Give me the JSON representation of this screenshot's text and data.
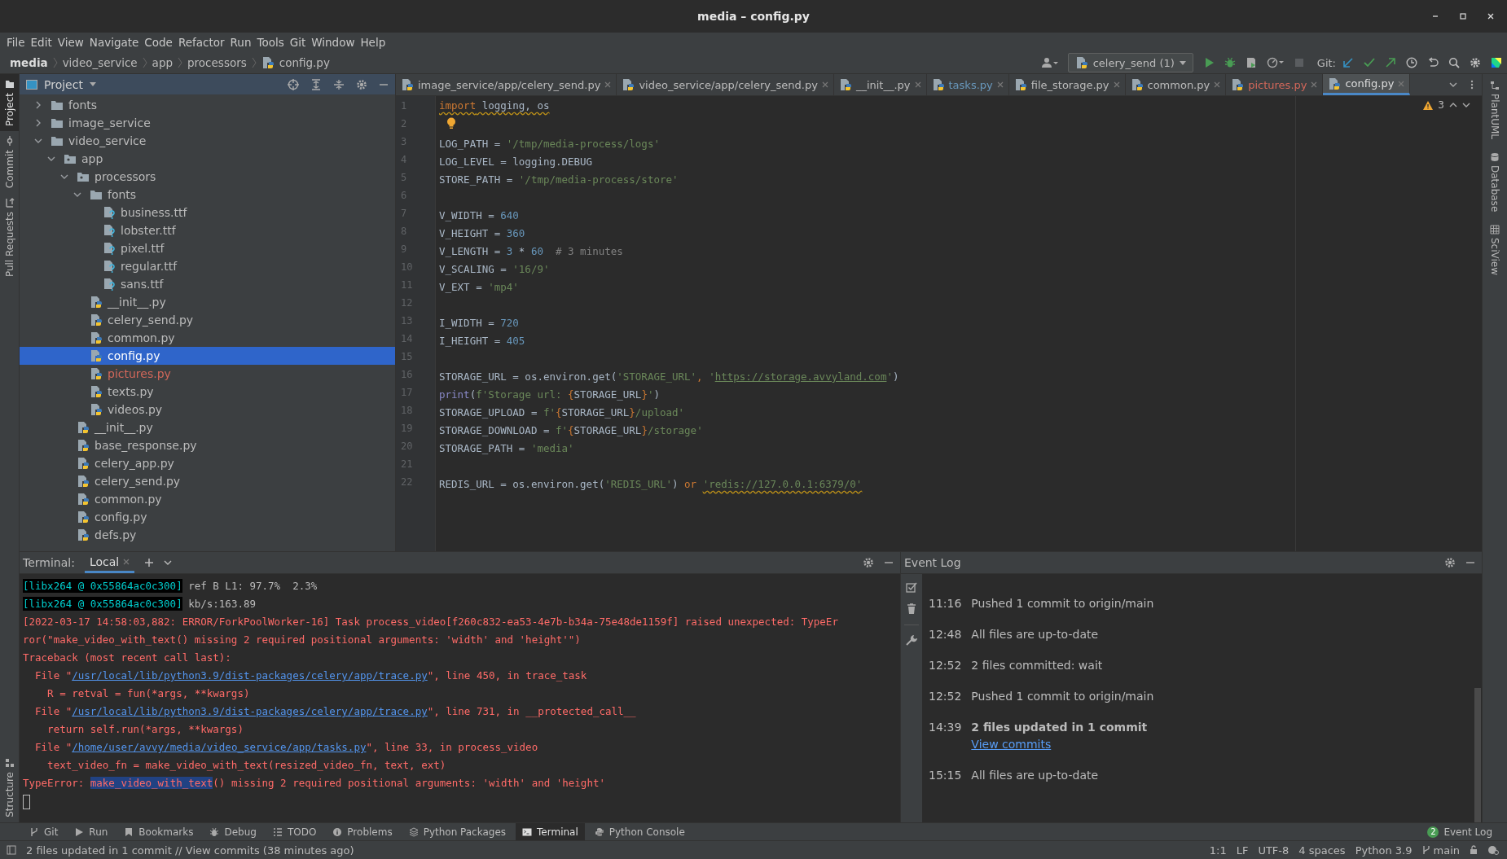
{
  "window": {
    "title": "media – config.py"
  },
  "menu": [
    "File",
    "Edit",
    "View",
    "Navigate",
    "Code",
    "Refactor",
    "Run",
    "Tools",
    "Git",
    "Window",
    "Help"
  ],
  "breadcrumbs": [
    {
      "text": "media",
      "kind": "project"
    },
    {
      "text": "video_service",
      "kind": "folder"
    },
    {
      "text": "app",
      "kind": "folder"
    },
    {
      "text": "processors",
      "kind": "folder"
    },
    {
      "text": "config.py",
      "kind": "file"
    }
  ],
  "toolbar": {
    "run_config": "celery_send (1)",
    "git_label": "Git:"
  },
  "left_stripe": [
    {
      "label": "Project",
      "selected": true,
      "kind": "project"
    },
    {
      "label": "Commit",
      "selected": false,
      "kind": "commit"
    },
    {
      "label": "Pull Requests",
      "selected": false,
      "kind": "pull"
    }
  ],
  "left_stripe_bottom": [
    {
      "label": "Structure",
      "selected": false,
      "kind": "structure"
    }
  ],
  "right_stripe": [
    {
      "label": "PlantUML",
      "kind": "plantuml"
    },
    {
      "label": "Database",
      "kind": "database"
    },
    {
      "label": "SciView",
      "kind": "sciview"
    }
  ],
  "project": {
    "title": "Project",
    "tree": [
      {
        "name": "fonts",
        "kind": "folder",
        "expanded": false,
        "selected": false
      },
      {
        "name": "image_service",
        "kind": "folder",
        "expanded": false,
        "selected": false
      },
      {
        "name": "video_service",
        "kind": "folder",
        "expanded": true,
        "selected": false,
        "children": [
          {
            "name": "app",
            "kind": "package",
            "expanded": true,
            "selected": false,
            "children": [
              {
                "name": "processors",
                "kind": "package",
                "expanded": true,
                "selected": false,
                "children": [
                  {
                    "name": "fonts",
                    "kind": "folder",
                    "expanded": true,
                    "selected": false,
                    "children": [
                      {
                        "name": "business.ttf",
                        "kind": "font",
                        "selected": false
                      },
                      {
                        "name": "lobster.ttf",
                        "kind": "font",
                        "selected": false
                      },
                      {
                        "name": "pixel.ttf",
                        "kind": "font",
                        "selected": false
                      },
                      {
                        "name": "regular.ttf",
                        "kind": "font",
                        "selected": false
                      },
                      {
                        "name": "sans.ttf",
                        "kind": "font",
                        "selected": false
                      }
                    ]
                  },
                  {
                    "name": "__init__.py",
                    "kind": "python",
                    "selected": false
                  },
                  {
                    "name": "celery_send.py",
                    "kind": "python",
                    "selected": false
                  },
                  {
                    "name": "common.py",
                    "kind": "python",
                    "selected": false
                  },
                  {
                    "name": "config.py",
                    "kind": "python",
                    "selected": true
                  },
                  {
                    "name": "pictures.py",
                    "kind": "python",
                    "selected": false,
                    "color": "#d1675a"
                  },
                  {
                    "name": "texts.py",
                    "kind": "python",
                    "selected": false
                  },
                  {
                    "name": "videos.py",
                    "kind": "python",
                    "selected": false
                  }
                ]
              },
              {
                "name": "__init__.py",
                "kind": "python",
                "selected": false
              },
              {
                "name": "base_response.py",
                "kind": "python",
                "selected": false
              },
              {
                "name": "celery_app.py",
                "kind": "python",
                "selected": false
              },
              {
                "name": "celery_send.py",
                "kind": "python",
                "selected": false
              },
              {
                "name": "common.py",
                "kind": "python",
                "selected": false
              },
              {
                "name": "config.py",
                "kind": "python",
                "selected": false
              },
              {
                "name": "defs.py",
                "kind": "python",
                "selected": false
              }
            ]
          }
        ]
      }
    ]
  },
  "editor": {
    "tabs": [
      {
        "label": "image_service/app/celery_send.py",
        "selected": false
      },
      {
        "label": "video_service/app/celery_send.py",
        "selected": false
      },
      {
        "label": "__init__.py",
        "selected": false
      },
      {
        "label": "tasks.py",
        "color": "#6897bb",
        "selected": false
      },
      {
        "label": "file_storage.py",
        "selected": false
      },
      {
        "label": "common.py",
        "selected": false
      },
      {
        "label": "pictures.py",
        "color": "#d1675a",
        "selected": false
      },
      {
        "label": "config.py",
        "selected": true
      }
    ],
    "warnings": "3",
    "lines": [
      {
        "number": "1",
        "tokens": [
          {
            "kind": "warned-keyword",
            "text": "import"
          },
          {
            "kind": "warned-plain",
            "text": " logging, os"
          }
        ]
      },
      {
        "number": "2",
        "tokens": [
          {
            "kind": "bulb"
          }
        ]
      },
      {
        "number": "3",
        "tokens": [
          {
            "kind": "plain",
            "text": "LOG_PATH = "
          },
          {
            "kind": "string",
            "text": "'/tmp/media-process/logs'"
          }
        ]
      },
      {
        "number": "4",
        "tokens": [
          {
            "kind": "plain",
            "text": "LOG_LEVEL = logging.DEBUG"
          }
        ]
      },
      {
        "number": "5",
        "tokens": [
          {
            "kind": "plain",
            "text": "STORE_PATH = "
          },
          {
            "kind": "string",
            "text": "'/tmp/media-process/store'"
          }
        ]
      },
      {
        "number": "6"
      },
      {
        "number": "7",
        "tokens": [
          {
            "kind": "plain",
            "text": "V_WIDTH = "
          },
          {
            "kind": "number",
            "text": "640"
          }
        ]
      },
      {
        "number": "8",
        "tokens": [
          {
            "kind": "plain",
            "text": "V_HEIGHT = "
          },
          {
            "kind": "number",
            "text": "360"
          }
        ]
      },
      {
        "number": "9",
        "tokens": [
          {
            "kind": "plain",
            "text": "V_LENGTH = "
          },
          {
            "kind": "number",
            "text": "3"
          },
          {
            "kind": "plain",
            "text": " * "
          },
          {
            "kind": "number",
            "text": "60"
          },
          {
            "kind": "comment",
            "text": "  # 3 minutes"
          }
        ]
      },
      {
        "number": "10",
        "tokens": [
          {
            "kind": "plain",
            "text": "V_SCALING = "
          },
          {
            "kind": "string",
            "text": "'16/9'"
          }
        ]
      },
      {
        "number": "11",
        "tokens": [
          {
            "kind": "plain",
            "text": "V_EXT = "
          },
          {
            "kind": "string",
            "text": "'mp4'"
          }
        ]
      },
      {
        "number": "12"
      },
      {
        "number": "13",
        "tokens": [
          {
            "kind": "plain",
            "text": "I_WIDTH = "
          },
          {
            "kind": "number",
            "text": "720"
          }
        ]
      },
      {
        "number": "14",
        "tokens": [
          {
            "kind": "plain",
            "text": "I_HEIGHT = "
          },
          {
            "kind": "number",
            "text": "405"
          }
        ]
      },
      {
        "number": "15"
      },
      {
        "number": "16",
        "tokens": [
          {
            "kind": "plain",
            "text": "STORAGE_URL = os.environ.get("
          },
          {
            "kind": "string",
            "text": "'STORAGE_URL'"
          },
          {
            "kind": "keyword",
            "text": ", "
          },
          {
            "kind": "string",
            "text": "'"
          },
          {
            "kind": "string-link",
            "text": "https://storage.avvyland.com"
          },
          {
            "kind": "string",
            "text": "'"
          },
          {
            "kind": "plain",
            "text": ")"
          }
        ]
      },
      {
        "number": "17",
        "tokens": [
          {
            "kind": "builtin",
            "text": "print"
          },
          {
            "kind": "plain",
            "text": "("
          },
          {
            "kind": "string",
            "text": "f'Storage url: "
          },
          {
            "kind": "brace",
            "text": "{"
          },
          {
            "kind": "plain",
            "text": "STORAGE_URL"
          },
          {
            "kind": "brace",
            "text": "}"
          },
          {
            "kind": "string",
            "text": "'"
          },
          {
            "kind": "plain",
            "text": ")"
          }
        ]
      },
      {
        "number": "18",
        "tokens": [
          {
            "kind": "plain",
            "text": "STORAGE_UPLOAD = "
          },
          {
            "kind": "string",
            "text": "f'"
          },
          {
            "kind": "brace",
            "text": "{"
          },
          {
            "kind": "plain",
            "text": "STORAGE_URL"
          },
          {
            "kind": "brace",
            "text": "}"
          },
          {
            "kind": "string",
            "text": "/upload'"
          }
        ]
      },
      {
        "number": "19",
        "tokens": [
          {
            "kind": "plain",
            "text": "STORAGE_DOWNLOAD = "
          },
          {
            "kind": "string",
            "text": "f'"
          },
          {
            "kind": "brace",
            "text": "{"
          },
          {
            "kind": "plain",
            "text": "STORAGE_URL"
          },
          {
            "kind": "brace",
            "text": "}"
          },
          {
            "kind": "string",
            "text": "/storage'"
          }
        ]
      },
      {
        "number": "20",
        "tokens": [
          {
            "kind": "plain",
            "text": "STORAGE_PATH = "
          },
          {
            "kind": "string",
            "text": "'media'"
          }
        ]
      },
      {
        "number": "21"
      },
      {
        "number": "22",
        "tokens": [
          {
            "kind": "plain",
            "text": "REDIS_URL = os.environ.get("
          },
          {
            "kind": "string",
            "text": "'REDIS_URL'"
          },
          {
            "kind": "plain",
            "text": ") "
          },
          {
            "kind": "keyword",
            "text": "or "
          },
          {
            "kind": "warned-string",
            "text": "'redis://127.0.0.1:6379/0'"
          }
        ]
      }
    ]
  },
  "terminal": {
    "title": "Terminal:",
    "tabs": [
      {
        "label": "Local",
        "selected": true
      }
    ],
    "cursor": true,
    "lines": [
      [
        {
          "kind": "prompt",
          "text": "[libx264 @ 0x55864ac0c300]"
        },
        {
          "kind": "plain",
          "text": " ref B L1: 97.7%  2.3%"
        }
      ],
      [
        {
          "kind": "prompt",
          "text": "[libx264 @ 0x55864ac0c300]"
        },
        {
          "kind": "plain",
          "text": " kb/s:163.89"
        }
      ],
      [
        {
          "kind": "error",
          "text": "[2022-03-17 14:58:03,882: ERROR/ForkPoolWorker-16] Task process_video[f260c832-ea53-4e7b-b34a-75e48de1159f] raised unexpected: TypeEr"
        }
      ],
      [
        {
          "kind": "error",
          "text": "ror(\"make_video_with_text() missing 2 required positional arguments: 'width' and 'height'\")"
        }
      ],
      [
        {
          "kind": "error",
          "text": "Traceback (most recent call last):"
        }
      ],
      [
        {
          "kind": "error",
          "text": "  File \""
        },
        {
          "kind": "link",
          "text": "/usr/local/lib/python3.9/dist-packages/celery/app/trace.py"
        },
        {
          "kind": "error",
          "text": "\", line 450, in trace_task"
        }
      ],
      [
        {
          "kind": "error",
          "text": "    R = retval = fun(*args, **kwargs)"
        }
      ],
      [
        {
          "kind": "error",
          "text": "  File \""
        },
        {
          "kind": "link",
          "text": "/usr/local/lib/python3.9/dist-packages/celery/app/trace.py"
        },
        {
          "kind": "error",
          "text": "\", line 731, in __protected_call__"
        }
      ],
      [
        {
          "kind": "error",
          "text": "    return self.run(*args, **kwargs)"
        }
      ],
      [
        {
          "kind": "error",
          "text": "  File \""
        },
        {
          "kind": "link",
          "text": "/home/user/avvy/media/video_service/app/tasks.py"
        },
        {
          "kind": "error",
          "text": "\", line 33, in process_video"
        }
      ],
      [
        {
          "kind": "error",
          "text": "    text_video_fn = make_video_with_text(resized_video_fn, text, ext)"
        }
      ],
      [
        {
          "kind": "error",
          "text": "TypeError: "
        },
        {
          "kind": "highlight",
          "text": "make_video_with_text"
        },
        {
          "kind": "error",
          "text": "() missing 2 required positional arguments: 'width' and 'height'"
        }
      ]
    ]
  },
  "event_log": {
    "title": "Event Log",
    "entries": [
      {
        "time": "11:16",
        "text": "Pushed 1 commit to origin/main",
        "bold": false
      },
      {
        "time": "12:48",
        "text": "All files are up-to-date",
        "bold": false
      },
      {
        "time": "12:52",
        "text": "2 files committed: wait",
        "bold": false
      },
      {
        "time": "12:52",
        "text": "Pushed 1 commit to origin/main",
        "bold": false
      },
      {
        "time": "14:39",
        "text": "2 files updated in 1 commit",
        "bold": true,
        "link": "View commits"
      },
      {
        "time": "15:15",
        "text": "All files are up-to-date",
        "bold": false
      }
    ]
  },
  "tool_buttons": [
    {
      "label": "Git",
      "kind": "git",
      "selected": false
    },
    {
      "label": "Run",
      "kind": "run",
      "selected": false
    },
    {
      "label": "Bookmarks",
      "kind": "bookmarks",
      "selected": false
    },
    {
      "label": "Debug",
      "kind": "debug",
      "selected": false
    },
    {
      "label": "TODO",
      "kind": "todo",
      "selected": false
    },
    {
      "label": "Problems",
      "kind": "problems",
      "selected": false
    },
    {
      "label": "Python Packages",
      "kind": "packages",
      "selected": false
    },
    {
      "label": "Terminal",
      "kind": "terminal",
      "selected": true
    },
    {
      "label": "Python Console",
      "kind": "console",
      "selected": false
    }
  ],
  "event_log_button": {
    "label": "Event Log",
    "badge": "2"
  },
  "status_bar": {
    "message": "2 files updated in 1 commit // View commits (38 minutes ago)",
    "items": [
      "1:1",
      "LF",
      "UTF-8",
      "4 spaces",
      "Python 3.9"
    ],
    "branch": "main"
  }
}
